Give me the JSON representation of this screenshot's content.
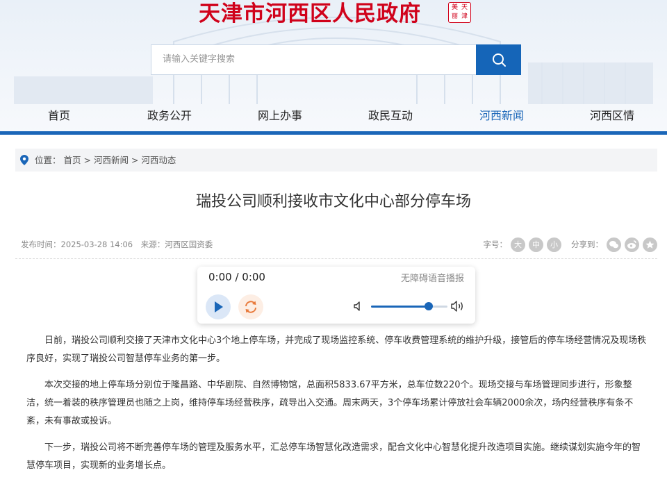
{
  "header": {
    "site_title": "天津市河西区人民政府",
    "seal_chars": [
      "美",
      "天",
      "丽",
      "津"
    ],
    "search_placeholder": "请输入关键字搜索"
  },
  "nav": {
    "items": [
      {
        "label": "首页"
      },
      {
        "label": "政务公开"
      },
      {
        "label": "网上办事"
      },
      {
        "label": "政民互动"
      },
      {
        "label": "河西新闻"
      },
      {
        "label": "河西区情"
      }
    ],
    "active_index": 4
  },
  "breadcrumb": {
    "prefix": "位置：",
    "items": [
      "首页",
      "河西新闻",
      "河西动态"
    ],
    "separator": " > "
  },
  "article": {
    "title": "瑞投公司顺利接收市文化中心部分停车场",
    "publish_time": "发布时间：2025-03-28 14:06",
    "source": "来源：河西区国资委",
    "font_size_label": "字号：",
    "font_sizes": [
      "大",
      "中",
      "小"
    ],
    "share_label": "分享到：",
    "paragraphs": [
      "日前，瑞投公司顺利交接了天津市文化中心3个地上停车场，并完成了现场监控系统、停车收费管理系统的维护升级，接管后的停车场经营情况及现场秩序良好，实现了瑞投公司智慧停车业务的第一步。",
      "本次交接的地上停车场分别位于隆昌路、中华剧院、自然博物馆，总面积5833.67平方米，总车位数220个。现场交接与车场管理同步进行，形象整洁，统一着装的秩序管理员也随之上岗，维持停车场经营秩序，疏导出入交通。周末两天，3个停车场累计停放社会车辆2000余次，场内经营秩序有条不紊，未有事故或投诉。",
      "下一步，瑞投公司将不断完善停车场的管理及服务水平，汇总停车场智慧化改造需求，配合文化中心智慧化提升改造项目实施。继续谋划实施今年的智慧停车项目，实现新的业务增长点。"
    ]
  },
  "player": {
    "time": "0:00 / 0:00",
    "tts_label": "无障碍语音播报",
    "volume": 0.75
  },
  "colors": {
    "brand_red": "#d0021b",
    "brand_blue": "#1a66b8"
  }
}
